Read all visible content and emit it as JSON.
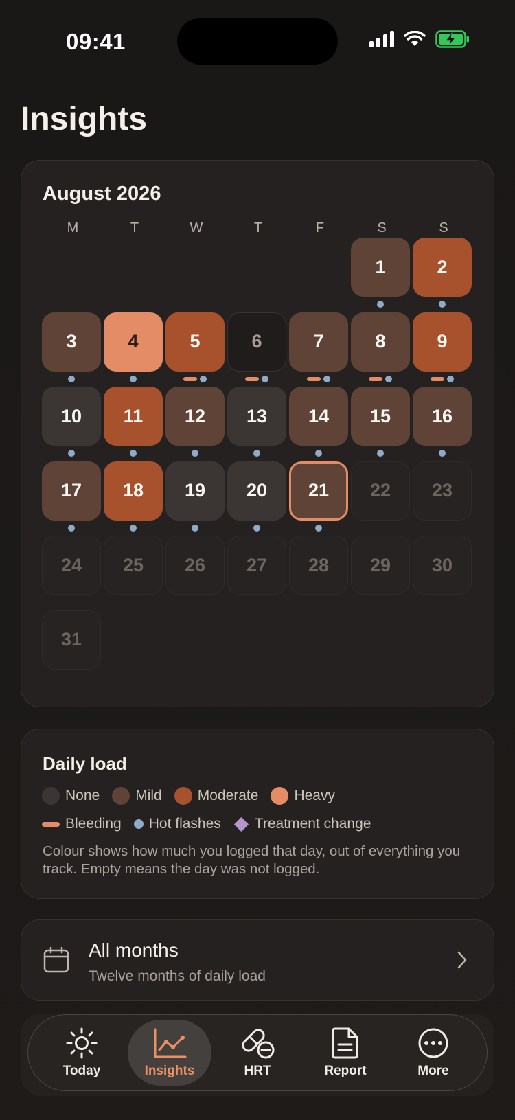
{
  "status": {
    "time": "09:41"
  },
  "page": {
    "title": "Insights"
  },
  "calendar": {
    "month": "August 2026",
    "weekdays": [
      "M",
      "T",
      "W",
      "T",
      "F",
      "S",
      "S"
    ],
    "days": [
      {
        "d": "1",
        "level": "mild",
        "hot": true,
        "bleed": false
      },
      {
        "d": "2",
        "level": "moderate",
        "hot": true,
        "bleed": false
      },
      {
        "d": "3",
        "level": "mild",
        "hot": true,
        "bleed": false
      },
      {
        "d": "4",
        "level": "heavy",
        "hot": true,
        "bleed": false
      },
      {
        "d": "5",
        "level": "moderate",
        "hot": true,
        "bleed": true
      },
      {
        "d": "6",
        "level": "empty",
        "hot": true,
        "bleed": true
      },
      {
        "d": "7",
        "level": "mild",
        "hot": true,
        "bleed": true
      },
      {
        "d": "8",
        "level": "mild",
        "hot": true,
        "bleed": true
      },
      {
        "d": "9",
        "level": "moderate",
        "hot": true,
        "bleed": true
      },
      {
        "d": "10",
        "level": "none",
        "hot": true,
        "bleed": false
      },
      {
        "d": "11",
        "level": "moderate",
        "hot": true,
        "bleed": false
      },
      {
        "d": "12",
        "level": "mild",
        "hot": true,
        "bleed": false
      },
      {
        "d": "13",
        "level": "none",
        "hot": true,
        "bleed": false
      },
      {
        "d": "14",
        "level": "mild",
        "hot": true,
        "bleed": false
      },
      {
        "d": "15",
        "level": "mild",
        "hot": true,
        "bleed": false
      },
      {
        "d": "16",
        "level": "mild",
        "hot": true,
        "bleed": false
      },
      {
        "d": "17",
        "level": "mild",
        "hot": true,
        "bleed": false
      },
      {
        "d": "18",
        "level": "moderate",
        "hot": true,
        "bleed": false
      },
      {
        "d": "19",
        "level": "none",
        "hot": true,
        "bleed": false
      },
      {
        "d": "20",
        "level": "none",
        "hot": true,
        "bleed": false
      },
      {
        "d": "21",
        "level": "today",
        "hot": true,
        "bleed": false
      },
      {
        "d": "22",
        "level": "faint",
        "hot": false,
        "bleed": false
      },
      {
        "d": "23",
        "level": "faint",
        "hot": false,
        "bleed": false
      },
      {
        "d": "24",
        "level": "faint",
        "hot": false,
        "bleed": false
      },
      {
        "d": "25",
        "level": "faint",
        "hot": false,
        "bleed": false
      },
      {
        "d": "26",
        "level": "faint",
        "hot": false,
        "bleed": false
      },
      {
        "d": "27",
        "level": "faint",
        "hot": false,
        "bleed": false
      },
      {
        "d": "28",
        "level": "faint",
        "hot": false,
        "bleed": false
      },
      {
        "d": "29",
        "level": "faint",
        "hot": false,
        "bleed": false
      },
      {
        "d": "30",
        "level": "faint",
        "hot": false,
        "bleed": false
      },
      {
        "d": "31",
        "level": "faint",
        "hot": false,
        "bleed": false
      }
    ]
  },
  "legend": {
    "title": "Daily load",
    "levels": [
      {
        "label": "None",
        "color": "#3b3634"
      },
      {
        "label": "Mild",
        "color": "#5e4336"
      },
      {
        "label": "Moderate",
        "color": "#a8512d"
      },
      {
        "label": "Heavy",
        "color": "#e38c66"
      }
    ],
    "markers": {
      "bleeding": "Bleeding",
      "hot": "Hot flashes",
      "treatment": "Treatment change"
    },
    "description": "Colour shows how much you logged that day, out of everything you track. Empty means the day was not logged."
  },
  "months": {
    "title": "All months",
    "subtitle": "Twelve months of daily load"
  },
  "tabs": [
    {
      "label": "Today",
      "icon": "sun-icon"
    },
    {
      "label": "Insights",
      "icon": "chart-icon"
    },
    {
      "label": "HRT",
      "icon": "pill-icon"
    },
    {
      "label": "Report",
      "icon": "document-icon"
    },
    {
      "label": "More",
      "icon": "more-icon"
    }
  ]
}
